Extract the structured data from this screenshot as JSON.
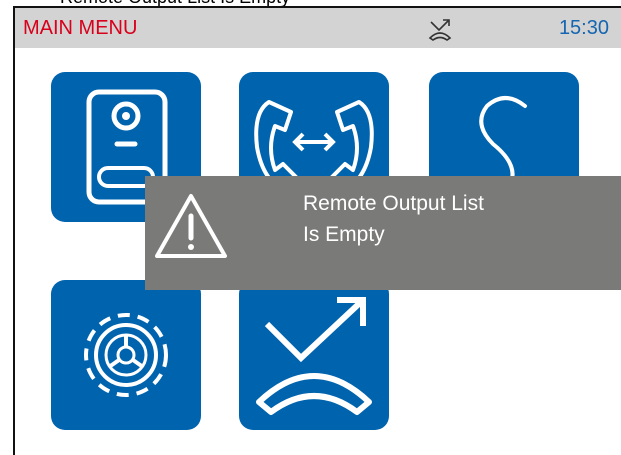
{
  "caption": "Remote Output List Is Empty",
  "header": {
    "title": "MAIN MENU",
    "time": "15:30",
    "status_icon": "call-forward-icon"
  },
  "menu": {
    "tiles": [
      {
        "icon": "door-panel-icon"
      },
      {
        "icon": "call-transfer-icon"
      },
      {
        "icon": "snake-icon"
      },
      {
        "icon": "settings-gear-icon"
      },
      {
        "icon": "call-forward-icon"
      }
    ]
  },
  "dialog": {
    "icon": "warning-icon",
    "line1": "Remote Output List",
    "line2": "Is Empty"
  },
  "colors": {
    "accent_blue": "#0063ad",
    "title_red": "#d9001b",
    "statusbar_gray": "#d3d3d3",
    "dialog_gray": "#7a7b79"
  }
}
